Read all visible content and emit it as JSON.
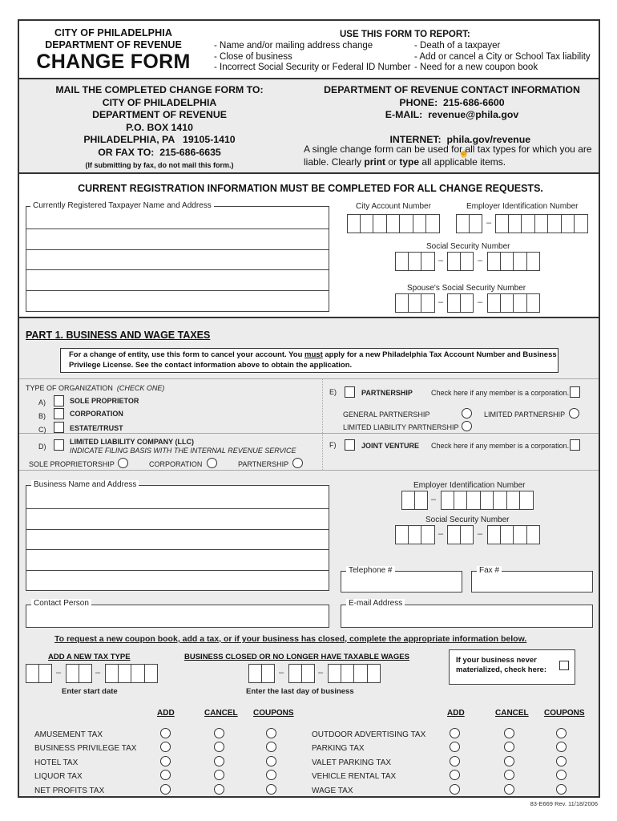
{
  "header": {
    "org_line1": "CITY OF PHILADELPHIA",
    "org_line2": "DEPARTMENT OF REVENUE",
    "form_title": "CHANGE FORM",
    "report_title": "USE THIS FORM TO REPORT:",
    "report_items_col1": [
      "- Name and/or mailing address change",
      "- Close of business",
      "- Incorrect Social Security or Federal ID Number"
    ],
    "report_items_col2": [
      "- Death of a taxpayer",
      "- Add or cancel a City or School Tax liability",
      "- Need for a new coupon book"
    ]
  },
  "mailing": {
    "title": "MAIL THE COMPLETED CHANGE FORM TO:",
    "line1": "CITY OF PHILADELPHIA",
    "line2": "DEPARTMENT OF REVENUE",
    "line3": "P.O. BOX 1410",
    "line4": "PHILADELPHIA, PA   19105-1410",
    "fax": "OR FAX TO:  215-686-6635",
    "fax_note": "(If submitting by fax, do not mail this form.)"
  },
  "contact": {
    "title": "DEPARTMENT OF REVENUE CONTACT INFORMATION",
    "phone": "PHONE:  215-686-6600",
    "email": "E-MAIL:  revenue@phila.gov",
    "internet": "INTERNET:  phila.gov/revenue",
    "link_icon": "pointer-hand-icon",
    "note_part1": "A single change form can be used for all tax types for which you are liable.  Clearly ",
    "note_print": "print",
    "note_or": " or ",
    "note_type": "type",
    "note_part2": " all applicable items."
  },
  "registration": {
    "title": "CURRENT REGISTRATION INFORMATION MUST BE COMPLETED FOR ALL CHANGE REQUESTS.",
    "name_address_label": "Currently Registered Taxpayer Name and Address",
    "city_account_label": "City Account Number",
    "ein_label": "Employer Identification Number",
    "ssn_label": "Social Security Number",
    "spouse_ssn_label": "Spouse's Social Security Number",
    "dash": "–"
  },
  "part1": {
    "title": "PART 1.  BUSINESS AND WAGE TAXES",
    "entity_note_a": "For a change of entity, use this form to cancel your account.  You ",
    "entity_note_must": "must",
    "entity_note_b": " apply for a new Philadelphia Tax Account Number and Business Privilege License.  See the contact information above to obtain the application.",
    "org_type_label": "TYPE OF ORGANIZATION",
    "org_type_hint": "(CHECK ONE)",
    "org_types": [
      {
        "letter": "A)",
        "label": "SOLE PROPRIETOR"
      },
      {
        "letter": "B)",
        "label": "CORPORATION"
      },
      {
        "letter": "C)",
        "label": "ESTATE/TRUST"
      },
      {
        "letter": "D)",
        "label": "LIMITED LIABILITY COMPANY (LLC)",
        "sublabel": "INDICATE FILING BASIS WITH THE INTERNAL REVENUE SERVICE"
      },
      {
        "letter": "E)",
        "label": "PARTNERSHIP"
      },
      {
        "letter": "F)",
        "label": "JOINT VENTURE"
      }
    ],
    "llc_basis": [
      "SOLE PROPRIETORSHIP",
      "CORPORATION",
      "PARTNERSHIP"
    ],
    "member_corp_label": "Check here if any member is a corporation.",
    "partnership_types": [
      "GENERAL PARTNERSHIP",
      "LIMITED PARTNERSHIP",
      "LIMITED LIABILITY PARTNERSHIP"
    ],
    "business_name_label": "Business Name and Address",
    "ein_label": "Employer Identification Number",
    "ssn_label": "Social Security Number",
    "telephone_label": "Telephone #",
    "fax_label": "Fax #",
    "contact_label": "Contact Person",
    "email_label": "E-mail Address"
  },
  "coupon": {
    "instructions": "To request a new coupon book, add a tax, or if your business has closed, complete the appropriate information below.",
    "add_tax_title": "ADD A NEW TAX TYPE",
    "add_tax_hint": "Enter start date",
    "closed_title": "BUSINESS CLOSED OR NO LONGER HAVE TAXABLE WAGES",
    "closed_hint": "Enter the last day of business",
    "never_materialized": "If your business never materialized, check here:",
    "col_headers": [
      "ADD",
      "CANCEL",
      "COUPONS"
    ],
    "taxes_left": [
      "AMUSEMENT TAX",
      "BUSINESS PRIVILEGE TAX",
      "HOTEL TAX",
      "LIQUOR TAX",
      "NET PROFITS TAX"
    ],
    "taxes_right": [
      "OUTDOOR ADVERTISING TAX",
      "PARKING TAX",
      "VALET PARKING TAX",
      "VEHICLE RENTAL TAX",
      "WAGE TAX"
    ]
  },
  "footer": {
    "form_id": "83-E669 Rev. 11/18/2006"
  }
}
